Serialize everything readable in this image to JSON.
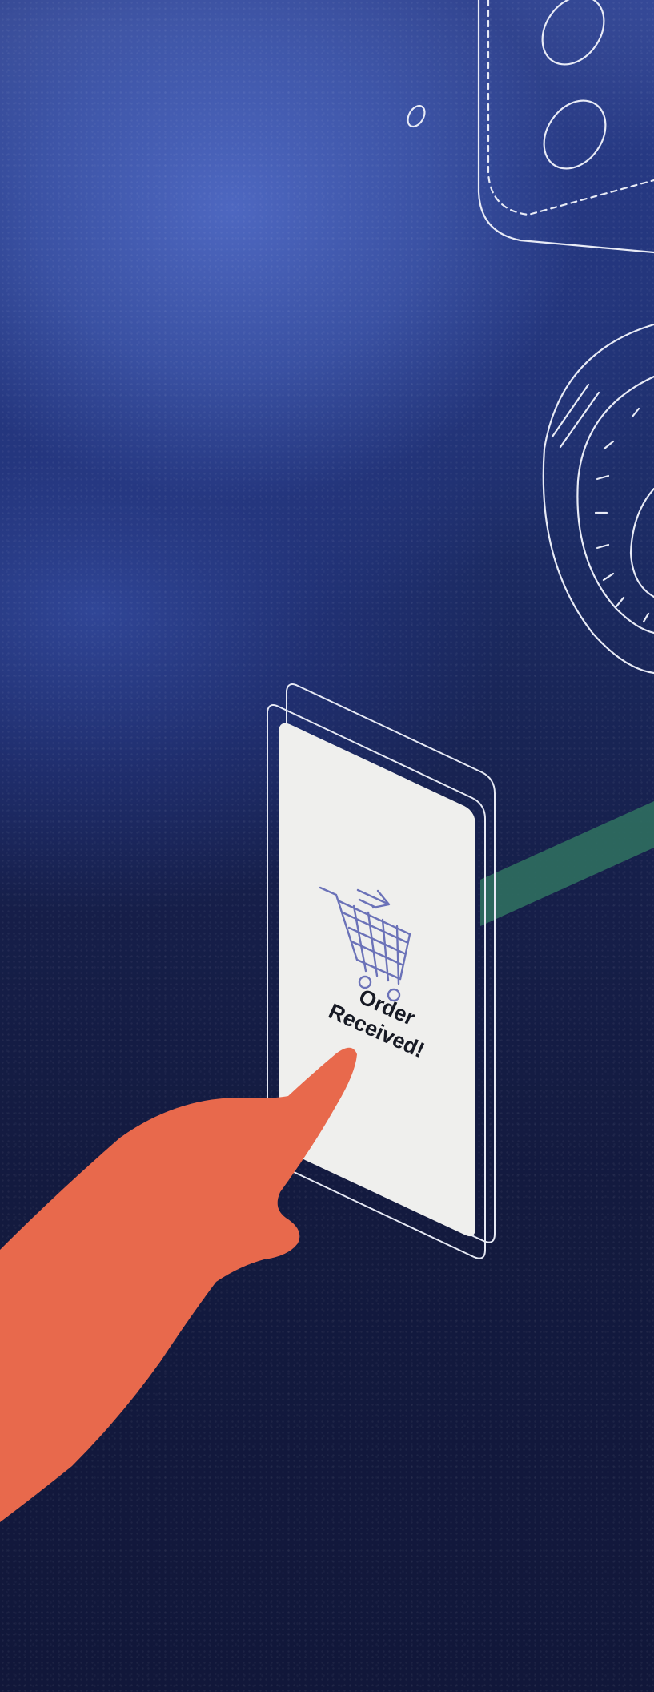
{
  "screen": {
    "status_line_1": "Order",
    "status_line_2": "Received!"
  },
  "icons": {
    "cart": "shopping-cart-icon",
    "arrow": "arrow-right-icon"
  },
  "colors": {
    "background_deep": "#11173a",
    "background_blue": "#3e56aa",
    "phone_screen": "#efefed",
    "outline": "#e6e9f4",
    "hand": "#e8694c",
    "green_beam": "#2f6e5f",
    "cart_stroke": "#6b72b8"
  }
}
